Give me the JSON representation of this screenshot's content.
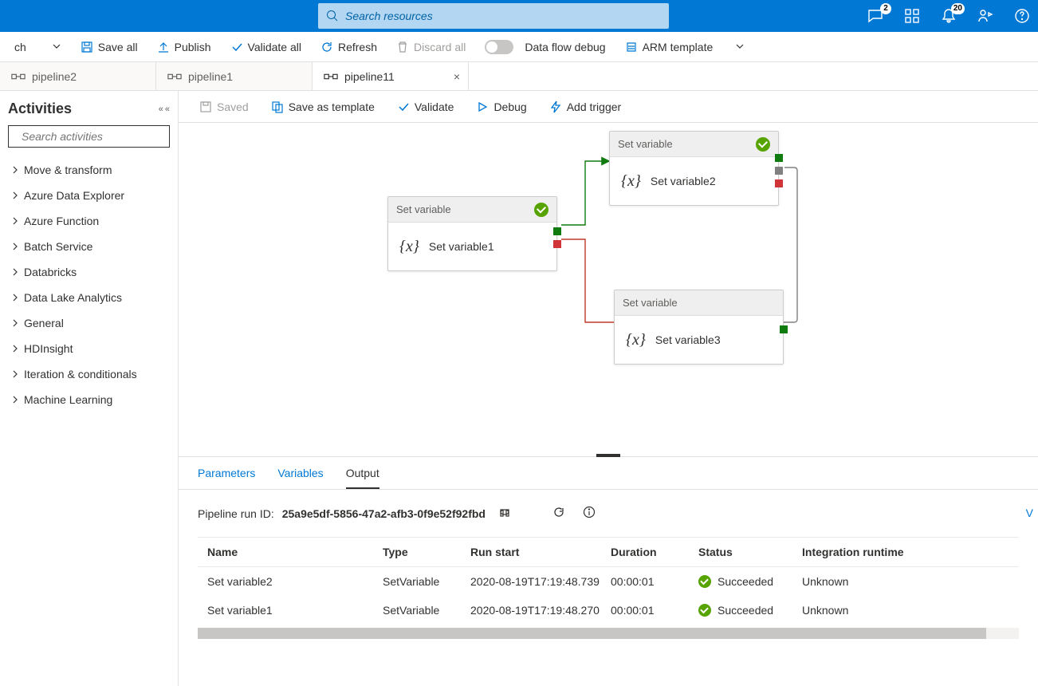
{
  "header": {
    "search_placeholder": "Search resources",
    "badges": {
      "chat": "2",
      "bell": "20"
    }
  },
  "cmdbar": {
    "branch": "ch",
    "save_all": "Save all",
    "publish": "Publish",
    "validate_all": "Validate all",
    "refresh": "Refresh",
    "discard_all": "Discard all",
    "data_flow_debug": "Data flow debug",
    "arm_template": "ARM template"
  },
  "tabs": [
    {
      "label": "pipeline2"
    },
    {
      "label": "pipeline1"
    },
    {
      "label": "pipeline11"
    }
  ],
  "sidebar": {
    "title": "Activities",
    "search_placeholder": "Search activities",
    "categories": [
      "Move & transform",
      "Azure Data Explorer",
      "Azure Function",
      "Batch Service",
      "Databricks",
      "Data Lake Analytics",
      "General",
      "HDInsight",
      "Iteration & conditionals",
      "Machine Learning"
    ]
  },
  "pipe_toolbar": {
    "saved": "Saved",
    "save_template": "Save as template",
    "validate": "Validate",
    "debug": "Debug",
    "add_trigger": "Add trigger"
  },
  "canvas": {
    "nodes": {
      "n1": {
        "type": "Set variable",
        "name": "Set variable1"
      },
      "n2": {
        "type": "Set variable",
        "name": "Set variable2"
      },
      "n3": {
        "type": "Set variable",
        "name": "Set variable3"
      }
    }
  },
  "bottom": {
    "tabs": {
      "parameters": "Parameters",
      "variables": "Variables",
      "output": "Output"
    },
    "run_id_label": "Pipeline run ID:",
    "run_id": "25a9e5df-5856-47a2-afb3-0f9e52f92fbd",
    "vright": "V",
    "columns": {
      "name": "Name",
      "type": "Type",
      "run_start": "Run start",
      "duration": "Duration",
      "status": "Status",
      "ir": "Integration runtime"
    },
    "rows": [
      {
        "name": "Set variable2",
        "type": "SetVariable",
        "run_start": "2020-08-19T17:19:48.739",
        "duration": "00:00:01",
        "status": "Succeeded",
        "ir": "Unknown"
      },
      {
        "name": "Set variable1",
        "type": "SetVariable",
        "run_start": "2020-08-19T17:19:48.270",
        "duration": "00:00:01",
        "status": "Succeeded",
        "ir": "Unknown"
      }
    ]
  }
}
